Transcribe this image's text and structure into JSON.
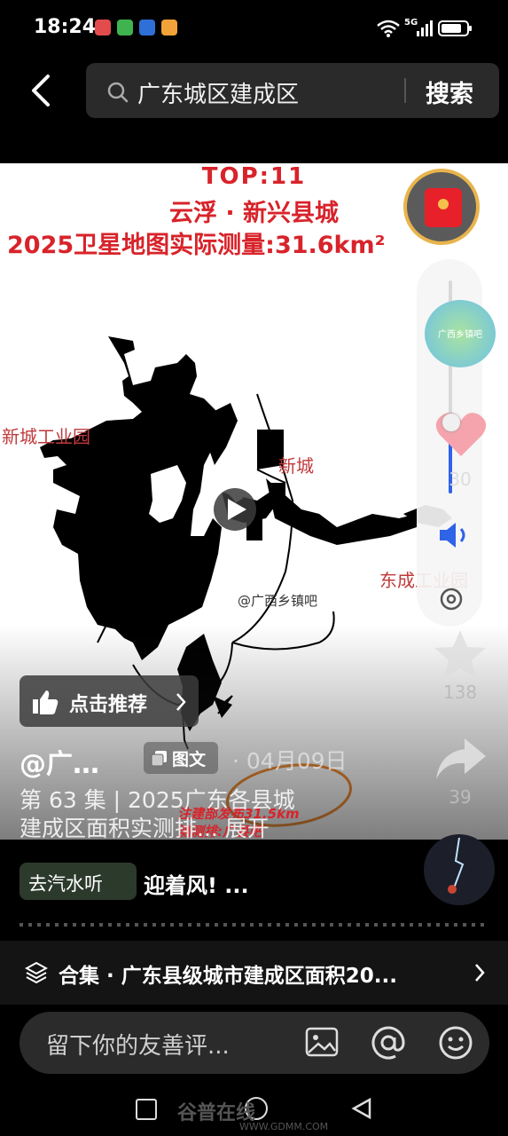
{
  "status_bar": {
    "time": "18:24",
    "network": "5G"
  },
  "search": {
    "query": "广东城区建成区",
    "button": "搜索"
  },
  "media": {
    "title_line1": "TOP:11",
    "title_line2": "云浮 · 新兴县城",
    "title_line3": "2025卫星地图实际测量:31.6km²",
    "labels": {
      "industrial_new": "新城工业园",
      "new_city": "新城",
      "east_industrial": "东成工业园"
    },
    "watermark": "@广西乡镇吧",
    "caption_overlay": "注建部发布31.5km",
    "caption_overlay2": "测测排:广县吧"
  },
  "overlay": {
    "recommend": "点击推荐",
    "author": "@广…",
    "badge": "图文",
    "date": "· 04月09日",
    "desc_line1": "第 63 集 | 2025广东各县城",
    "desc_line2": "建成区面积实测排... 展开"
  },
  "rail": {
    "volume_value": "30",
    "like_count": "138",
    "share_count": "39",
    "map_thumb_label": "广西乡镇吧"
  },
  "music": {
    "chip": "去汽水听",
    "song": "迎着风! ..."
  },
  "collection": {
    "label": "合集 · 广东县级城市建成区面积20..."
  },
  "comment": {
    "placeholder": "留下你的友善评..."
  },
  "site": {
    "mark": "谷普在线",
    "url": "WWW.GDMM.COM"
  },
  "colors": {
    "accent_red": "#d8232a",
    "label_red": "#c0393b",
    "circle_orange": "#f0872a"
  }
}
